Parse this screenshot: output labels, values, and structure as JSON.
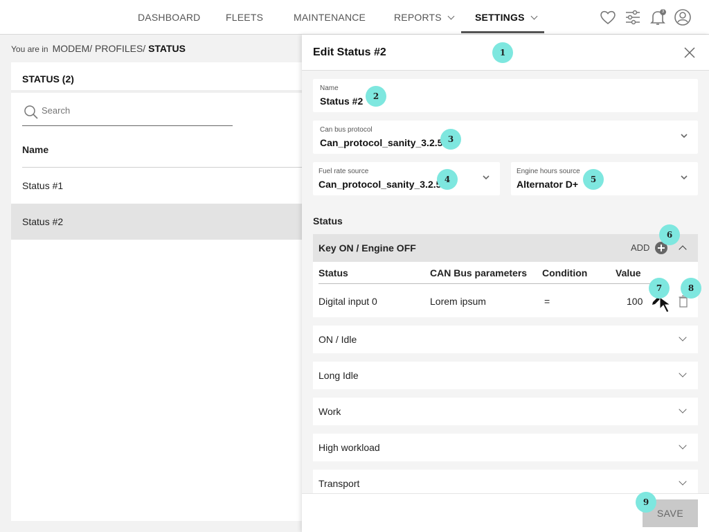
{
  "nav": {
    "items": [
      {
        "label": "DASHBOARD"
      },
      {
        "label": "FLEETS"
      },
      {
        "label": "MAINTENANCE"
      },
      {
        "label": "REPORTS"
      },
      {
        "label": "SETTINGS"
      }
    ],
    "notification_count": "3"
  },
  "breadcrumb": {
    "prefix": "You are in",
    "path": "MODEM/ PROFILES/",
    "current": "STATUS"
  },
  "left": {
    "header": "STATUS (2)",
    "search_placeholder": "Search",
    "column": "Name",
    "rows": [
      "Status #1",
      "Status #2"
    ]
  },
  "drawer": {
    "title": "Edit Status #2",
    "name_label": "Name",
    "name_value": "Status #2",
    "can_label": "Can bus protocol",
    "can_value": "Can_protocol_sanity_3.2.5",
    "fuel_label": "Fuel rate source",
    "fuel_value": "Can_protocol_sanity_3.2.5",
    "engine_label": "Engine hours source",
    "engine_value": "Alternator D+",
    "section_title": "Status",
    "open_group": {
      "title": "Key ON / Engine OFF",
      "add_label": "ADD",
      "columns": [
        "Status",
        "CAN Bus parameters",
        "Condition",
        "Value"
      ],
      "row": {
        "status": "Digital input 0",
        "param": "Lorem ipsum",
        "condition": "=",
        "value": "100"
      }
    },
    "groups": [
      "ON / Idle",
      "Long Idle",
      "Work",
      "High workload",
      "Transport"
    ],
    "save_label": "SAVE"
  },
  "markers": [
    "1",
    "2",
    "3",
    "4",
    "5",
    "6",
    "7",
    "8",
    "9"
  ],
  "colors": {
    "marker": "#7ee7df",
    "selected_row": "#e3e3e3",
    "save_disabled": "#c9c9c9"
  }
}
